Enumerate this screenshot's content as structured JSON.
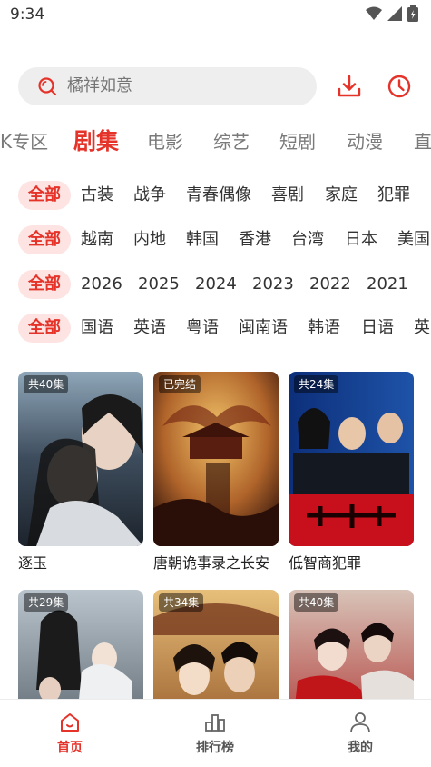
{
  "status_bar": {
    "time": "9:34"
  },
  "search": {
    "placeholder": "橘祥如意"
  },
  "categories": [
    "K专区",
    "剧集",
    "电影",
    "综艺",
    "短剧",
    "动漫",
    "直"
  ],
  "active_category": "剧集",
  "filters": [
    {
      "all": "全部",
      "items": [
        "古装",
        "战争",
        "青春偶像",
        "喜剧",
        "家庭",
        "犯罪"
      ]
    },
    {
      "all": "全部",
      "items": [
        "越南",
        "内地",
        "韩国",
        "香港",
        "台湾",
        "日本",
        "美国"
      ]
    },
    {
      "all": "全部",
      "items": [
        "2026",
        "2025",
        "2024",
        "2023",
        "2022",
        "2021"
      ]
    },
    {
      "all": "全部",
      "items": [
        "国语",
        "英语",
        "粤语",
        "闽南语",
        "韩语",
        "日语",
        "英"
      ]
    }
  ],
  "shows": [
    {
      "title": "逐玉",
      "badge": "共40集"
    },
    {
      "title": "唐朝诡事录之长安",
      "badge": "已完结"
    },
    {
      "title": "低智商犯罪",
      "badge": "共24集"
    },
    {
      "title": "",
      "badge": "共29集"
    },
    {
      "title": "",
      "badge": "共34集"
    },
    {
      "title": "",
      "badge": "共40集"
    }
  ],
  "bottom_nav": [
    {
      "label": "首页",
      "icon": "home-icon"
    },
    {
      "label": "排行榜",
      "icon": "ranking-icon"
    },
    {
      "label": "我的",
      "icon": "profile-icon"
    }
  ],
  "colors": {
    "accent": "#e5332a",
    "chip_bg": "#fde4e3",
    "search_bg": "#eeeeee"
  }
}
